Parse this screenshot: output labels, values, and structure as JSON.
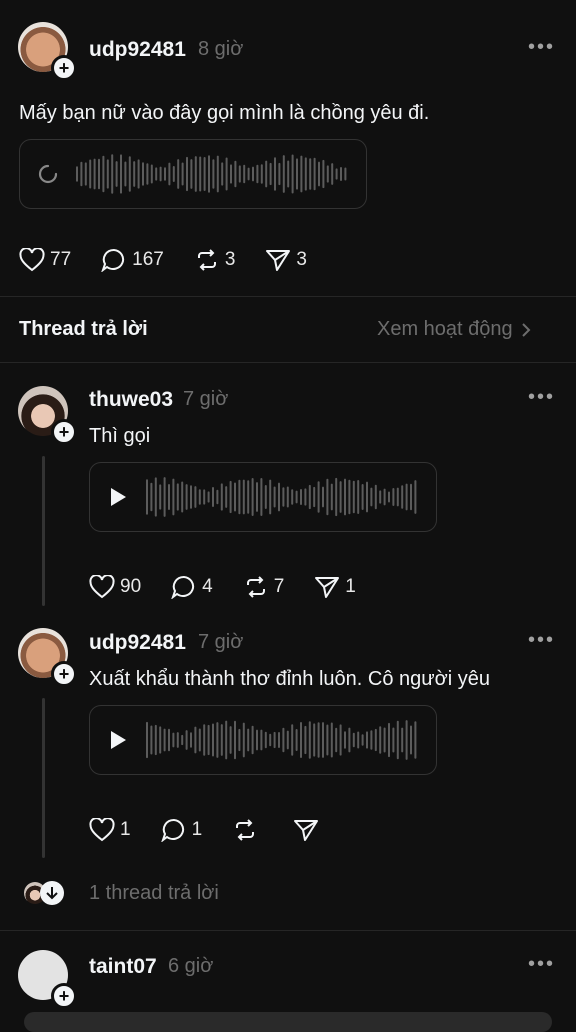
{
  "post": {
    "username": "udp92481",
    "time": "8 giờ",
    "text": "Mấy bạn nữ vào đây gọi mình là chồng yêu đi.",
    "likes": "77",
    "replies": "167",
    "reposts": "3",
    "shares": "3"
  },
  "section": {
    "title": "Thread trả lời",
    "link": "Xem hoạt động"
  },
  "replies": [
    {
      "username": "thuwe03",
      "time": "7 giờ",
      "text": "Thì gọi",
      "likes": "90",
      "replies": "4",
      "reposts": "7",
      "shares": "1"
    },
    {
      "username": "udp92481",
      "time": "7 giờ",
      "text": "Xuất khẩu thành thơ đỉnh luôn. Cô người yêu",
      "likes": "1",
      "replies": "1"
    }
  ],
  "more_thread": "1 thread trả lời",
  "next": {
    "username": "taint07",
    "time": "6 giờ"
  },
  "icons": {
    "like": "heart-icon",
    "reply": "comment-icon",
    "repost": "repost-icon",
    "share": "send-icon",
    "play": "play-icon",
    "loading": "loading-icon",
    "more": "more-icon"
  }
}
